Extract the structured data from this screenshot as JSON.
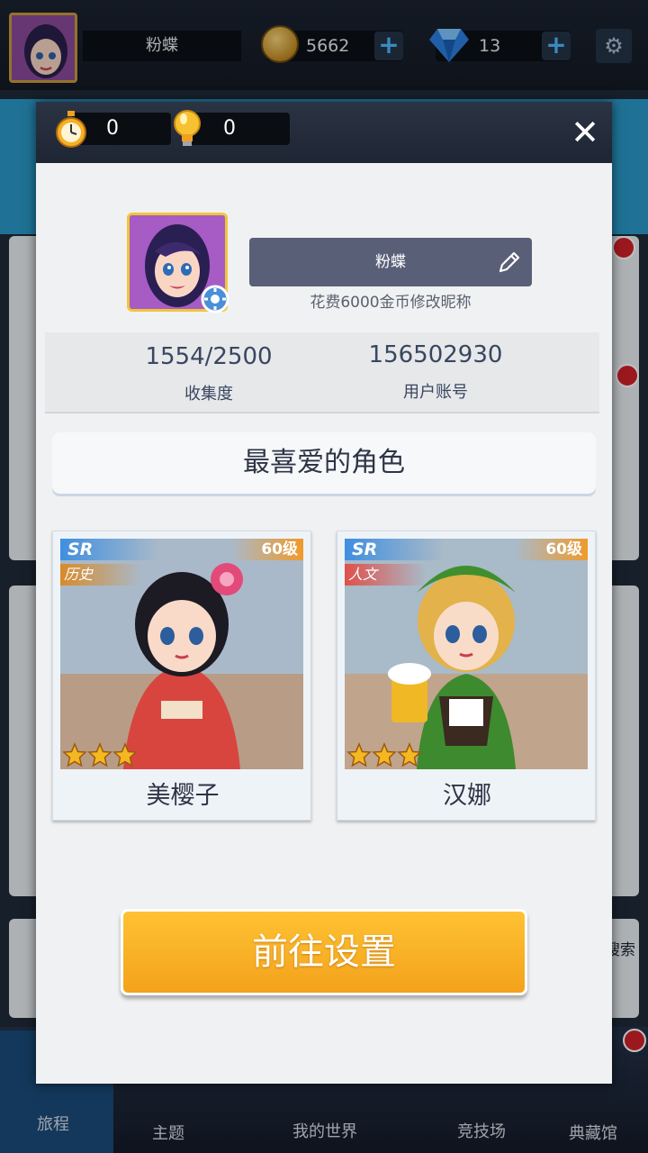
{
  "topbar": {
    "player_name": "粉蝶",
    "coins": "5662",
    "gems": "13",
    "plus_label": "+",
    "settings_icon": "gear-icon"
  },
  "bottom_tabs": [
    {
      "label": "旅程"
    },
    {
      "label": "主题"
    },
    {
      "label": "我的世界"
    },
    {
      "label": "竞技场"
    },
    {
      "label": "典藏馆"
    }
  ],
  "background": {
    "side_text": "搜索"
  },
  "profile_modal": {
    "timer_count": "0",
    "hint_count": "0",
    "close_label": "✕",
    "nickname": "粉蝶",
    "rename_hint": "花费6000金币修改昵称",
    "collection_value": "1554/2500",
    "collection_label": "收集度",
    "account_value": "156502930",
    "account_label": "用户账号",
    "favorite_title": "最喜爱的角色",
    "characters": [
      {
        "rarity": "SR",
        "level": "60级",
        "category": "历史",
        "name": "美樱子",
        "stars": 3,
        "category_color": "#d88a2a"
      },
      {
        "rarity": "SR",
        "level": "60级",
        "category": "人文",
        "name": "汉娜",
        "stars": 3,
        "category_color": "#e0504a"
      }
    ],
    "goto_button": "前往设置"
  },
  "colors": {
    "accent_orange": "#f3a21b",
    "header_dark": "#1e2533",
    "name_field": "#5a5f78",
    "star_gold": "#f5b820"
  }
}
